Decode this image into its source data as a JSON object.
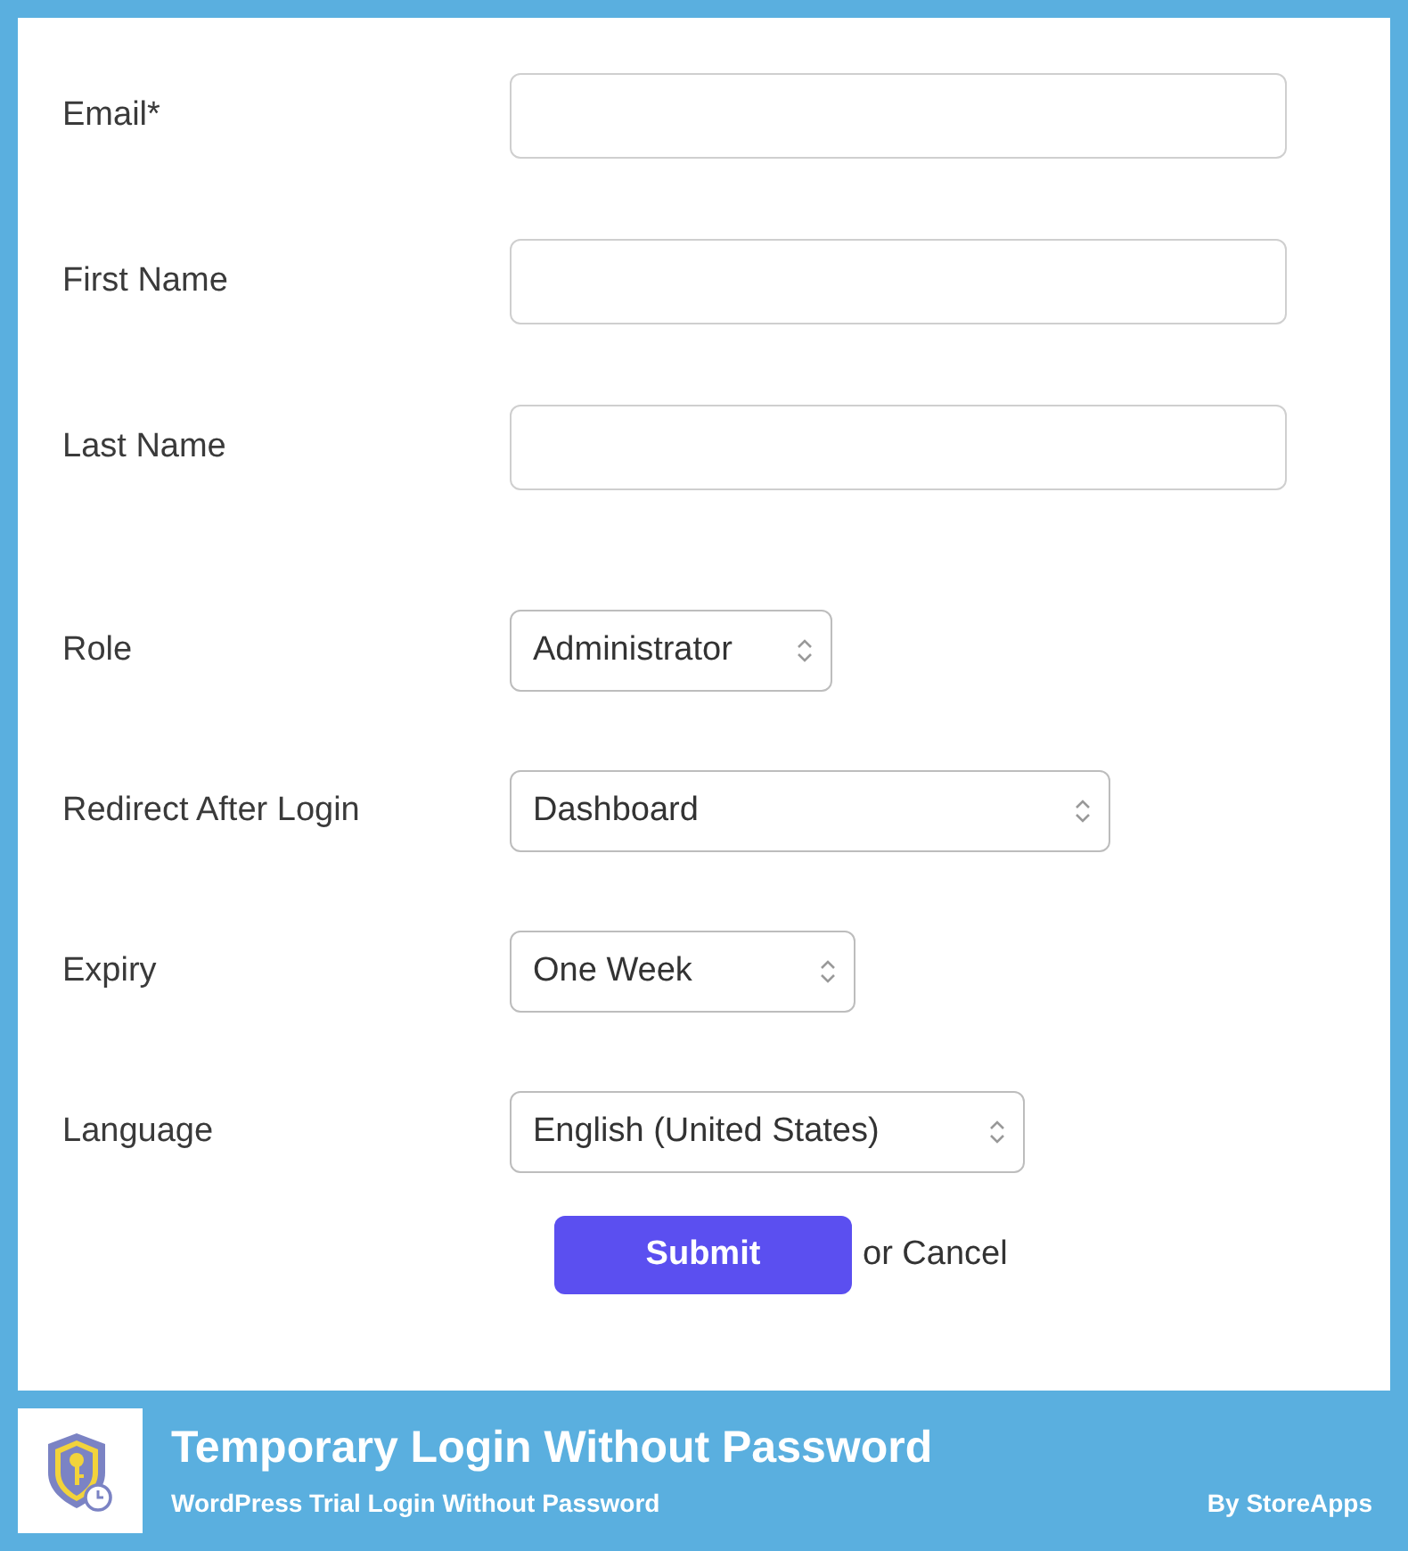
{
  "form": {
    "fields": [
      {
        "kind": "text",
        "label": "Email*"
      },
      {
        "kind": "text",
        "label": "First Name"
      },
      {
        "kind": "text",
        "label": "Last Name"
      },
      {
        "kind": "select",
        "label": "Role",
        "value": "Administrator"
      },
      {
        "kind": "select",
        "label": "Redirect After Login",
        "value": "Dashboard"
      },
      {
        "kind": "select",
        "label": "Expiry",
        "value": "One Week"
      },
      {
        "kind": "select",
        "label": "Language",
        "value": "English (United States)"
      }
    ],
    "submit": "Submit",
    "cancel": "or Cancel"
  },
  "banner": {
    "title": "Temporary Login Without Password",
    "subtitle": "WordPress Trial Login Without Password",
    "author": "By StoreApps"
  }
}
